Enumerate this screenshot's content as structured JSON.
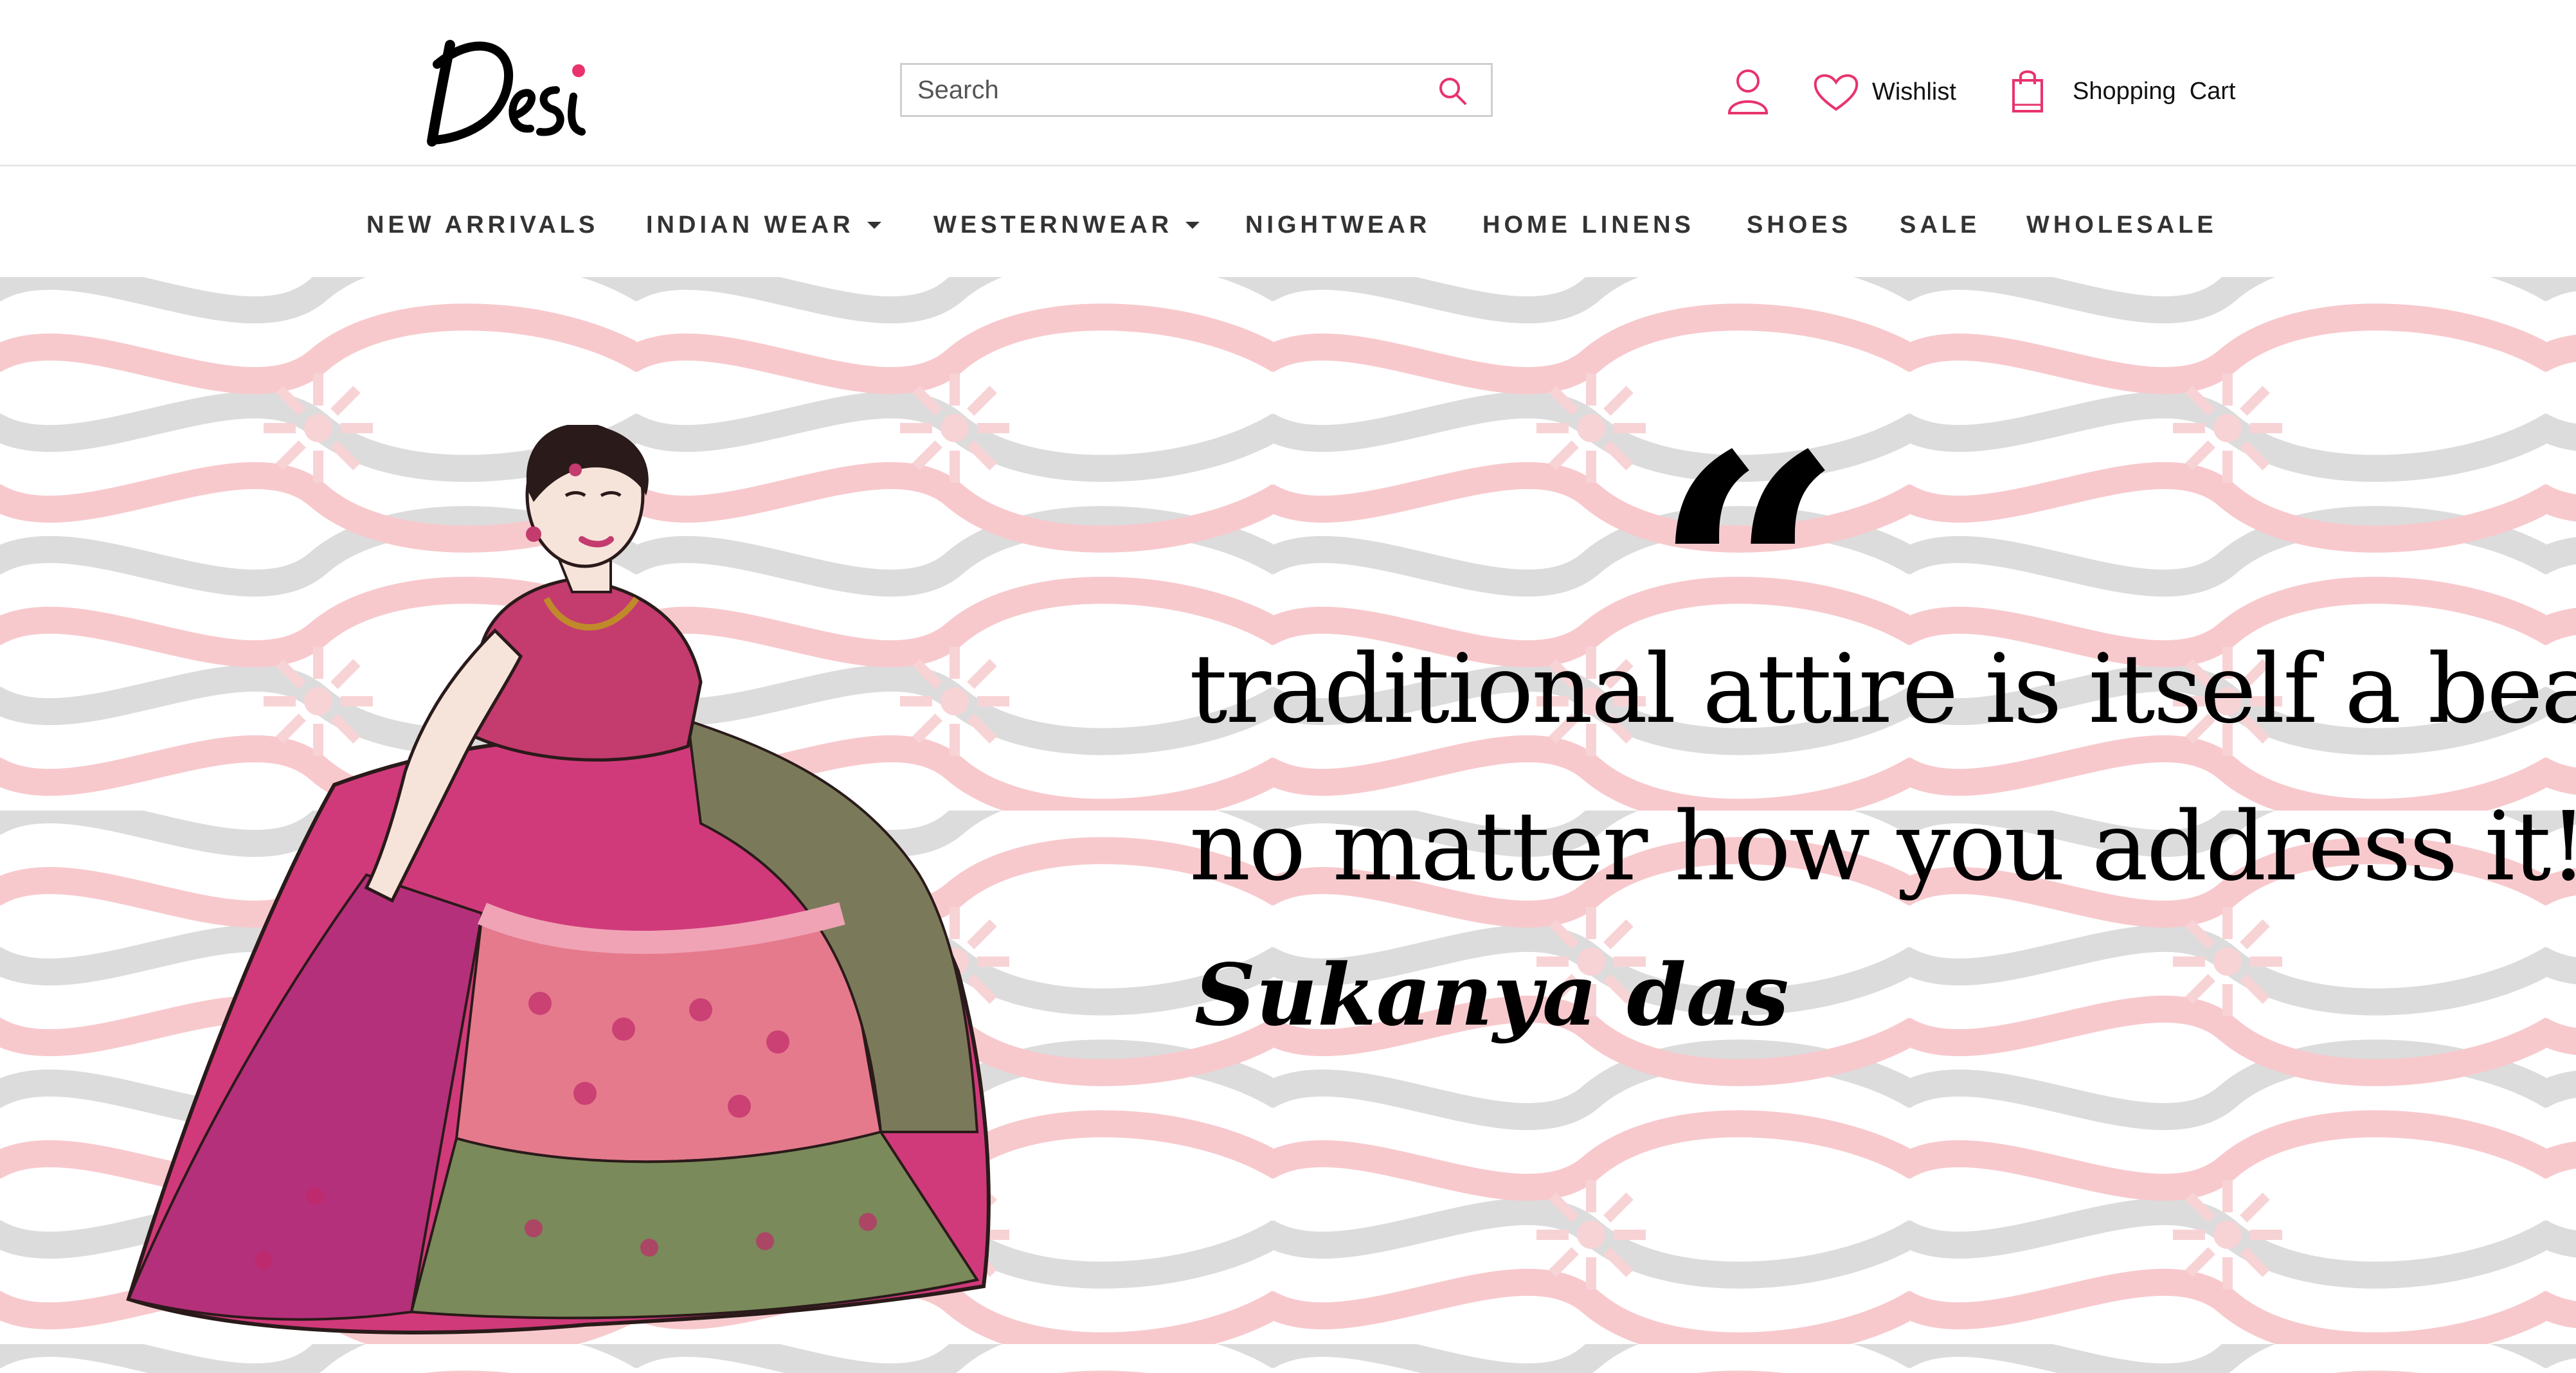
{
  "brand": {
    "logo_text": "Desi",
    "accent_color": "#e8336d"
  },
  "search": {
    "placeholder": "Search"
  },
  "header_actions": {
    "account_icon": "user-icon",
    "wishlist_label": "Wishlist",
    "wishlist_icon": "heart-icon",
    "cart_label": "Shopping  Cart",
    "cart_icon": "shopping-bag-icon",
    "icon_color": "#e8336d"
  },
  "nav": {
    "items": [
      {
        "label": "NEW ARRIVALS",
        "has_dropdown": false
      },
      {
        "label": "INDIAN WEAR",
        "has_dropdown": true
      },
      {
        "label": "WESTERNWEAR",
        "has_dropdown": true
      },
      {
        "label": "NIGHTWEAR",
        "has_dropdown": false
      },
      {
        "label": "HOME LINENS",
        "has_dropdown": false
      },
      {
        "label": "SHOES",
        "has_dropdown": false
      },
      {
        "label": "SALE",
        "has_dropdown": false
      },
      {
        "label": "WHOLESALE",
        "has_dropdown": false
      }
    ]
  },
  "hero": {
    "quote_mark": "“",
    "quote_line_1": "traditional attire is itself a beauty.",
    "quote_line_2": "no matter how you address it!",
    "author": "Sukanya das",
    "pattern_colors": {
      "pink": "#f7c9cd",
      "gray": "#dcdcdc"
    }
  }
}
